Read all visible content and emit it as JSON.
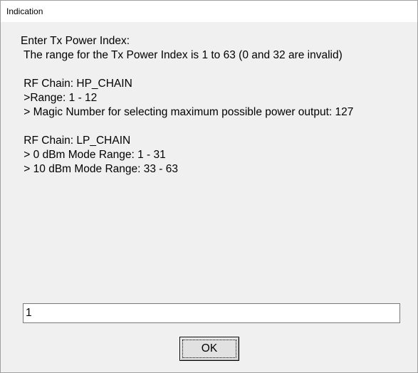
{
  "window": {
    "title": "Indication"
  },
  "message": {
    "lines": [
      "Enter Tx Power Index:",
      " The range for the Tx Power Index is 1 to 63 (0 and 32 are invalid)",
      "",
      " RF Chain: HP_CHAIN",
      " >Range: 1 - 12",
      " > Magic Number for selecting maximum possible power output: 127",
      "",
      " RF Chain: LP_CHAIN",
      " > 0 dBm Mode Range: 1 - 31",
      " > 10 dBm Mode Range: 33 - 63"
    ]
  },
  "input": {
    "value": "1"
  },
  "buttons": {
    "ok_label": "OK"
  }
}
